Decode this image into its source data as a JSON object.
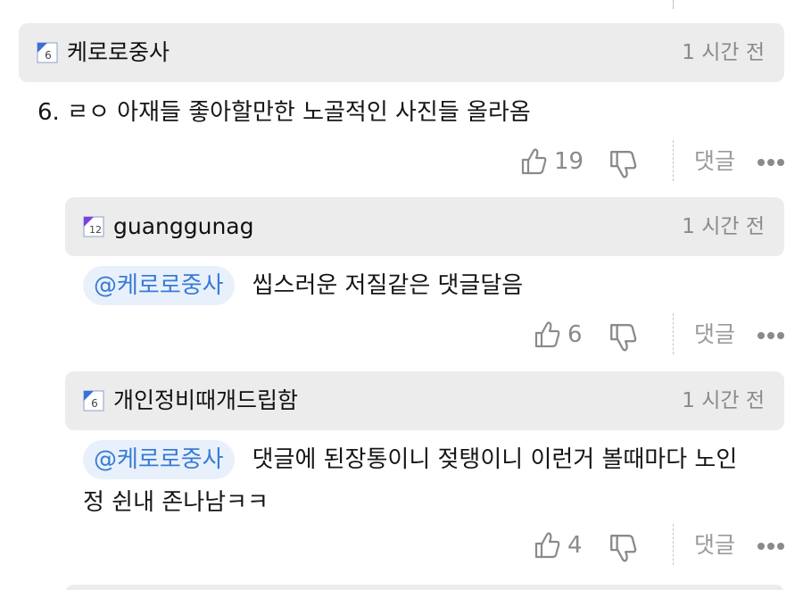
{
  "comments": [
    {
      "level_badge": "6",
      "nickname": "케로로중사",
      "time": "1 시간 전",
      "body": "6. ㄹㅇ 아재들 좋아할만한 노골적인 사진들 올라옴",
      "likes": "19",
      "reply_label": "댓글"
    },
    {
      "level_badge": "12",
      "nickname": "guanggunag",
      "time": "1 시간 전",
      "mention": "@케로로중사",
      "body": "씹스러운 저질같은 댓글달음",
      "likes": "6",
      "reply_label": "댓글"
    },
    {
      "level_badge": "6",
      "nickname": "개인정비때개드립함",
      "time": "1 시간 전",
      "mention": "@케로로중사",
      "body_line1": "댓글에 된장통이니 젖탱이니 이런거 볼때마다 노인",
      "body_line2": "정 쉰내 존나남ㅋㅋ",
      "likes": "4",
      "reply_label": "댓글"
    }
  ],
  "icons": {
    "like": "thumbs-up-icon",
    "dislike": "thumbs-down-icon",
    "more": "more-dots-icon",
    "level": "level-badge-icon"
  },
  "colors": {
    "header_bg": "#ececec",
    "mention_bg": "#e8f1fb",
    "mention_text": "#3a7bd5",
    "meta_gray": "#8a8a8a",
    "badge_blue": "#3d6fd6",
    "badge_purple": "#7b3fe4"
  }
}
